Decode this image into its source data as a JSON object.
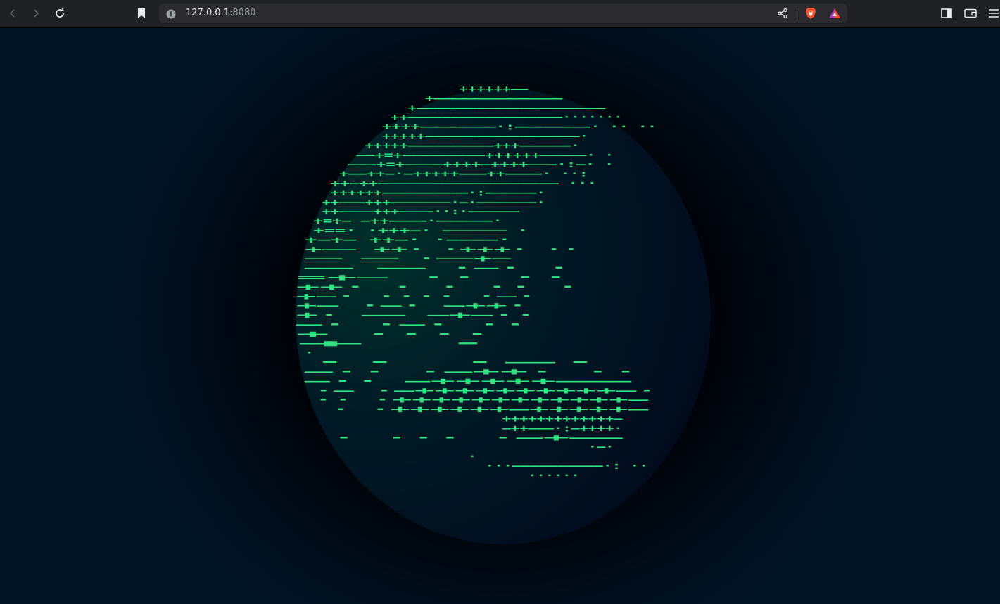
{
  "browser": {
    "url_host": "127.0.0.1:",
    "url_port": "8080",
    "icons": {
      "back": "back-arrow-icon",
      "forward": "forward-arrow-icon",
      "reload": "reload-icon",
      "bookmark": "bookmark-icon",
      "site_info": "info-icon",
      "share": "share-icon",
      "brave_shields": "brave-lion-icon",
      "brave_rewards": "brave-rewards-triangle-icon",
      "sidebar": "sidebar-icon",
      "wallet": "wallet-icon",
      "menu": "hamburger-menu-icon"
    }
  },
  "page": {
    "colors": {
      "background_edge": "#011426",
      "globe_light": "#00302a",
      "globe_dark": "#010a1c",
      "glyph": "#2fe37f"
    },
    "ascii_globe": [
      {
        "row": 0,
        "col": 19,
        "text": "++++++——"
      },
      {
        "row": 1,
        "col": 15,
        "text": "+———————————————"
      },
      {
        "row": 2,
        "col": 13,
        "text": "+——————————————————————"
      },
      {
        "row": 3,
        "col": 11,
        "text": "++——————————————————·······"
      },
      {
        "row": 4,
        "col": 10,
        "text": "++++————————·:————————·   ··  ··"
      },
      {
        "row": 5,
        "col": 10,
        "text": "+++++——————————————————·"
      },
      {
        "row": 6,
        "col": 8,
        "text": "+++++——————————+++——————·"
      },
      {
        "row": 7,
        "col": 7,
        "text": "——+=+—————————++++++—————·   ·"
      },
      {
        "row": 8,
        "col": 6,
        "text": "———+=+————++++—++++———·:—·    ·"
      },
      {
        "row": 9,
        "col": 5,
        "text": "+——++—·—+++++———++————·   ··:"
      },
      {
        "row": 10,
        "col": 4,
        "text": "++—++———————————————————    ···"
      },
      {
        "row": 11,
        "col": 4,
        "text": "++++++——————————·:——————·"
      },
      {
        "row": 12,
        "col": 3,
        "text": "++———+++———————·—·———————·"
      },
      {
        "row": 13,
        "col": 3,
        "text": "++————+++————··:·——————"
      },
      {
        "row": 14,
        "col": 2,
        "text": "+=+—   —++————·——————·"
      },
      {
        "row": 15,
        "col": 2,
        "text": "+==·   ·+++—·   ——————  ·"
      },
      {
        "row": 16,
        "col": 1,
        "text": "+—+—      ++—·    ·————·"
      },
      {
        "row": 17,
        "col": 1,
        "text": "+——       ++·      ·+++·      ··"
      },
      {
        "row": 18,
        "col": 1,
        "text": "——        ——       ·——+—"
      },
      {
        "row": 19,
        "col": 1,
        "text": "——        ——         ·—·      ·"
      },
      {
        "row": 20,
        "col": 0,
        "text": "=+—       ··                  ··"
      },
      {
        "row": 21,
        "col": 0,
        "text": "++·        ·        ·      ··   ·"
      },
      {
        "row": 22,
        "col": 0,
        "text": "+—·              ····    ·—·"
      },
      {
        "row": 23,
        "col": 0,
        "text": "+—               ·—·   —++·"
      },
      {
        "row": 24,
        "col": 0,
        "text": "+·                ——   —+—··"
      },
      {
        "row": 25,
        "col": 0,
        "text": "—·                ·—·    ··"
      },
      {
        "row": 26,
        "col": 0,
        "text": "+                  ····"
      },
      {
        "row": 27,
        "col": 0,
        "text": "+                      ·"
      },
      {
        "row": 28,
        "col": 1,
        "text": "·"
      },
      {
        "row": 29,
        "col": 1,
        "text": "··                              ·—·"
      },
      {
        "row": 30,
        "col": 1,
        "text": "—··                           ·—++·  ··"
      },
      {
        "row": 31,
        "col": 1,
        "text": "—··                          —+++++———"
      },
      {
        "row": 32,
        "col": 2,
        "text": "·—                        ·—++++++++++—·"
      },
      {
        "row": 33,
        "col": 2,
        "text": "··                       ·++++++++++++—"
      },
      {
        "row": 34,
        "col": 4,
        "text": "·                      ·++++++—+++++—"
      },
      {
        "row": 35,
        "col": 24,
        "text": "+++++++++++++—"
      },
      {
        "row": 36,
        "col": 24,
        "text": "—++———·:—++++·"
      },
      {
        "row": 37,
        "col": 4,
        "text": "·                   ···      ·—+——"
      },
      {
        "row": 38,
        "col": 34,
        "text": "·—·"
      },
      {
        "row": 39,
        "col": 20,
        "text": "·"
      },
      {
        "row": 40,
        "col": 22,
        "text": "···——————————·:  ··"
      },
      {
        "row": 41,
        "col": 27,
        "text": "······"
      }
    ]
  }
}
